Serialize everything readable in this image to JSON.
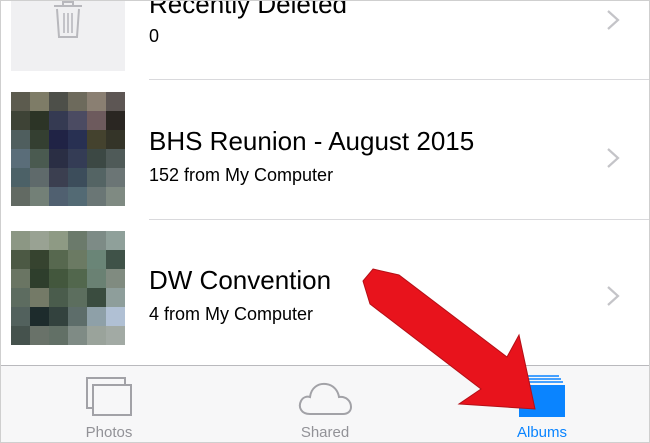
{
  "albums": [
    {
      "title": "Recently Deleted",
      "count": "0",
      "thumb_icon": "trash-icon"
    },
    {
      "title": "BHS Reunion - August 2015",
      "count": "152 from My Computer",
      "thumb_icon": "pixelated-photo"
    },
    {
      "title": "DW Convention",
      "count": "4 from My Computer",
      "thumb_icon": "pixelated-photo"
    }
  ],
  "tabbar": {
    "tabs": [
      {
        "label": "Photos",
        "icon": "photos-stack-icon",
        "active": false
      },
      {
        "label": "Shared",
        "icon": "cloud-icon",
        "active": false
      },
      {
        "label": "Albums",
        "icon": "albums-icon",
        "active": true
      }
    ]
  },
  "colors": {
    "active_tab": "#0a84ff",
    "inactive_tab": "#929297",
    "annotation_arrow": "#e8131c"
  }
}
